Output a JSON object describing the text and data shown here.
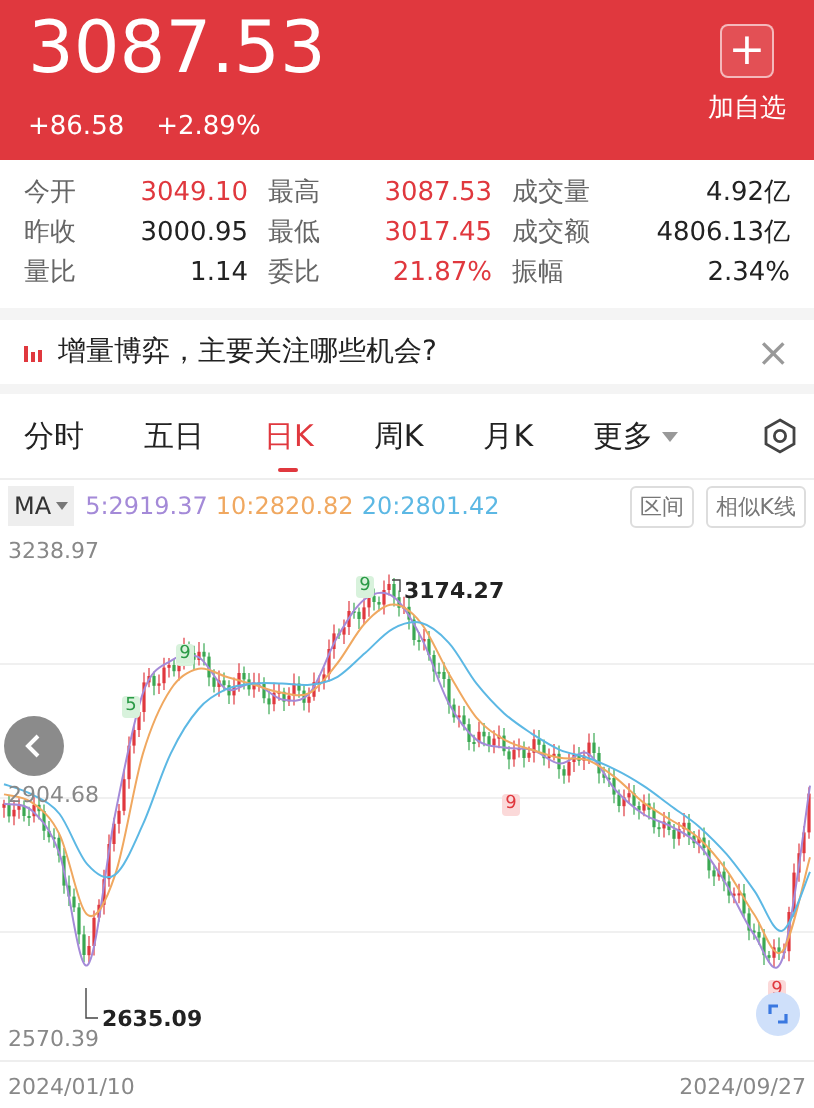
{
  "header": {
    "price": "3087.53",
    "change": "+86.58",
    "change_pct": "+2.89%",
    "add_button": "+",
    "add_label": "加自选"
  },
  "stats": [
    {
      "label": "今开",
      "value": "3049.10",
      "color": "#e0383e"
    },
    {
      "label": "最高",
      "value": "3087.53",
      "color": "#e0383e"
    },
    {
      "label": "成交量",
      "value": "4.92亿",
      "color": "#222222"
    },
    {
      "label": "昨收",
      "value": "3000.95",
      "color": "#222222"
    },
    {
      "label": "最低",
      "value": "3017.45",
      "color": "#e0383e"
    },
    {
      "label": "成交额",
      "value": "4806.13亿",
      "color": "#222222"
    },
    {
      "label": "量比",
      "value": "1.14",
      "color": "#222222"
    },
    {
      "label": "委比",
      "value": "21.87%",
      "color": "#e0383e"
    },
    {
      "label": "振幅",
      "value": "2.34%",
      "color": "#222222"
    }
  ],
  "banner": {
    "text": "增量博弈，主要关注哪些机会?",
    "close": "×"
  },
  "tabs": [
    {
      "label": "分时",
      "selected": false
    },
    {
      "label": "五日",
      "selected": false
    },
    {
      "label": "日K",
      "selected": true
    },
    {
      "label": "周K",
      "selected": false
    },
    {
      "label": "月K",
      "selected": false
    },
    {
      "label": "更多",
      "selected": false,
      "kind": "dropdown"
    }
  ],
  "ma_bar": {
    "selector": "MA",
    "buttons": [
      "区间",
      "相似K线"
    ]
  },
  "chart": {
    "chart_data": {
      "type": "line",
      "ylim": [
        2476,
        3265
      ],
      "yticks": [
        {
          "value": 3238.97,
          "label": "3238.97"
        },
        {
          "value": 2904.68,
          "label": "2904.68"
        },
        {
          "value": 2570.39,
          "label": "2570.39"
        }
      ],
      "series": [
        {
          "name": "5:2919.37",
          "color": "#a48ad8",
          "values": [
            2894,
            2885,
            2825,
            2673,
            2880,
            3046,
            3090,
            3095,
            3051,
            3059,
            3037,
            3046,
            3123,
            3175,
            3178,
            3123,
            3032,
            2982,
            2971,
            2968,
            2949,
            2963,
            2913,
            2880,
            2863,
            2838,
            2783,
            2714,
            2681,
            2919
          ]
        },
        {
          "name": "10:2820.82",
          "color": "#f0a860",
          "values": [
            2907,
            2896,
            2852,
            2742,
            2797,
            2963,
            3051,
            3079,
            3068,
            3057,
            3046,
            3046,
            3087,
            3142,
            3167,
            3142,
            3073,
            3012,
            2982,
            2968,
            2957,
            2954,
            2930,
            2896,
            2872,
            2847,
            2803,
            2742,
            2692,
            2821
          ]
        },
        {
          "name": "20:2801.42",
          "color": "#5cb8e4",
          "values": [
            2921,
            2907,
            2880,
            2811,
            2797,
            2866,
            2963,
            3024,
            3051,
            3059,
            3059,
            3057,
            3068,
            3101,
            3134,
            3142,
            3115,
            3059,
            3018,
            2990,
            2968,
            2957,
            2941,
            2919,
            2891,
            2863,
            2825,
            2775,
            2720,
            2801
          ]
        }
      ]
    },
    "high_label": "3174.27",
    "low_label": "2635.09",
    "date_start": "2024/01/10",
    "date_end": "2024/09/27",
    "marks": [
      {
        "text": "5",
        "kind": "buy"
      },
      {
        "text": "9",
        "kind": "buy"
      },
      {
        "text": "9",
        "kind": "buy"
      },
      {
        "text": "9",
        "kind": "sell"
      },
      {
        "text": "9",
        "kind": "sell"
      }
    ]
  }
}
